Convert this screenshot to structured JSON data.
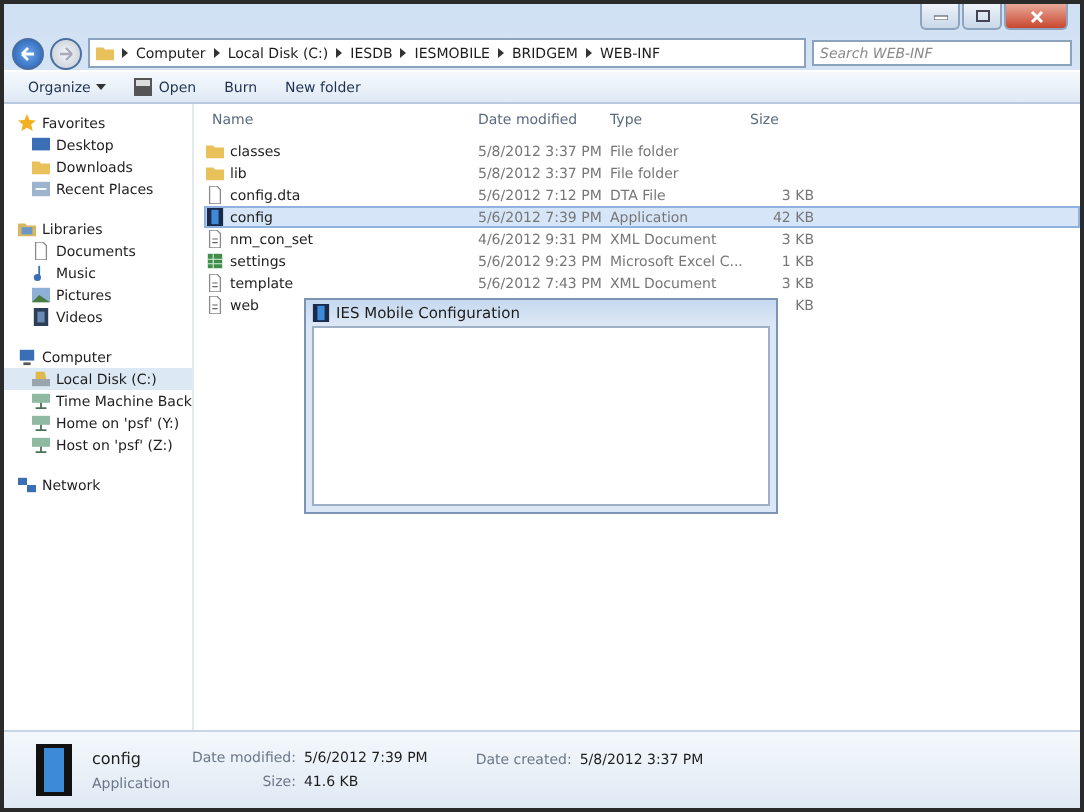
{
  "address_bar": {
    "segments": [
      "Computer",
      "Local Disk (C:)",
      "IESDB",
      "IESMOBILE",
      "BRIDGEM",
      "WEB-INF"
    ]
  },
  "search": {
    "placeholder": "Search WEB-INF"
  },
  "toolbar": {
    "buttons": [
      {
        "label": "Organize",
        "kind": "menu"
      },
      {
        "label": "Open",
        "kind": "icon"
      },
      {
        "label": "Burn",
        "kind": "plain"
      },
      {
        "label": "New folder",
        "kind": "plain"
      }
    ]
  },
  "sidebar": {
    "groups": [
      {
        "label": "Favorites",
        "kind": "star",
        "children": [
          {
            "label": "Desktop",
            "kind": "desktop",
            "selected": false
          },
          {
            "label": "Downloads",
            "kind": "folder",
            "selected": false
          },
          {
            "label": "Recent Places",
            "kind": "recent",
            "selected": false
          }
        ]
      },
      {
        "label": "Libraries",
        "kind": "library",
        "children": [
          {
            "label": "Documents",
            "kind": "document",
            "selected": false
          },
          {
            "label": "Music",
            "kind": "music",
            "selected": false
          },
          {
            "label": "Pictures",
            "kind": "picture",
            "selected": false
          },
          {
            "label": "Videos",
            "kind": "video",
            "selected": false
          }
        ]
      },
      {
        "label": "Computer",
        "kind": "computer",
        "children": [
          {
            "label": "Local Disk (C:)",
            "kind": "drive",
            "selected": true
          },
          {
            "label": "Time Machine Back",
            "kind": "netdrive",
            "selected": false
          },
          {
            "label": "Home on 'psf' (Y:)",
            "kind": "netdrive",
            "selected": false
          },
          {
            "label": "Host on 'psf' (Z:)",
            "kind": "netdrive",
            "selected": false
          }
        ]
      },
      {
        "label": "Network",
        "kind": "network"
      }
    ]
  },
  "table": {
    "columns": [
      "Name",
      "Date modified",
      "Type",
      "Size"
    ],
    "rows": [
      {
        "name": "classes",
        "date": "5/8/2012 3:37 PM",
        "type": "File folder",
        "kind": "folder",
        "selected": false
      },
      {
        "name": "lib",
        "date": "5/8/2012 3:37 PM",
        "type": "File folder",
        "kind": "folder",
        "selected": false
      },
      {
        "name": "config.dta",
        "date": "5/6/2012 7:12 PM",
        "type": "DTA File",
        "size": "3 KB",
        "kind": "file",
        "selected": false
      },
      {
        "name": "config",
        "date": "5/6/2012 7:39 PM",
        "type": "Application",
        "size": "42 KB",
        "kind": "app",
        "selected": true
      },
      {
        "name": "nm_con_set",
        "date": "4/6/2012 9:31 PM",
        "type": "XML Document",
        "size": "3 KB",
        "kind": "xml",
        "selected": false
      },
      {
        "name": "settings",
        "date": "5/6/2012 9:23 PM",
        "type": "Microsoft Excel C...",
        "size": "1 KB",
        "kind": "excel",
        "selected": false
      },
      {
        "name": "template",
        "date": "5/6/2012 7:43 PM",
        "type": "XML Document",
        "size": "3 KB",
        "kind": "xml",
        "selected": false
      },
      {
        "name": "web",
        "size": "KB",
        "kind": "xml",
        "selected": false
      }
    ]
  },
  "dialog": {
    "title": "IES Mobile Configuration"
  },
  "details": {
    "name": "config",
    "type": "Application",
    "modified_label": "Date modified:",
    "modified": "5/6/2012 7:39 PM",
    "size_label": "Size:",
    "size": "41.6 KB",
    "created_label": "Date created:",
    "created": "5/8/2012 3:37 PM"
  }
}
